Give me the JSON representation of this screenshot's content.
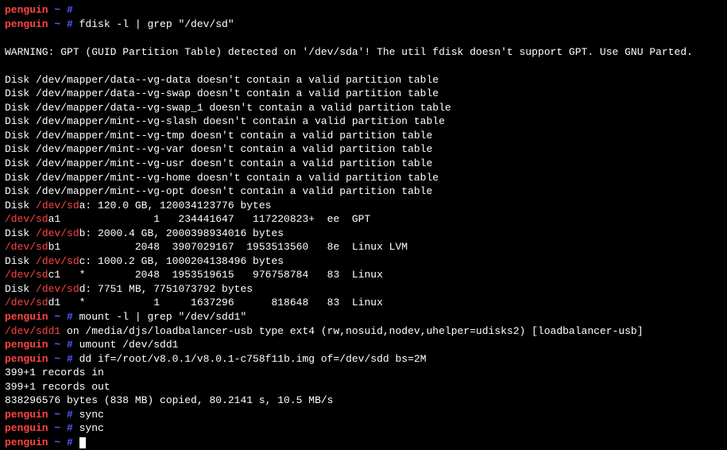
{
  "host": "penguin",
  "path": "~",
  "prompt_symbol": "#",
  "lines": [
    {
      "segments": [
        {
          "cls": "red",
          "t": "penguin"
        },
        {
          "cls": "blue",
          "t": " ~ #"
        }
      ]
    },
    {
      "segments": [
        {
          "cls": "red",
          "t": "penguin"
        },
        {
          "cls": "blue",
          "t": " ~ # "
        },
        {
          "cls": "white",
          "t": "fdisk -l | grep \"/dev/sd\""
        }
      ]
    },
    {
      "segments": [
        {
          "cls": "white",
          "t": " "
        }
      ]
    },
    {
      "segments": [
        {
          "cls": "white",
          "t": "WARNING: GPT (GUID Partition Table) detected on '/dev/sda'! The util fdisk doesn't support GPT. Use GNU Parted."
        }
      ]
    },
    {
      "segments": [
        {
          "cls": "white",
          "t": " "
        }
      ]
    },
    {
      "segments": [
        {
          "cls": "white",
          "t": "Disk /dev/mapper/data--vg-data doesn't contain a valid partition table"
        }
      ]
    },
    {
      "segments": [
        {
          "cls": "white",
          "t": "Disk /dev/mapper/data--vg-swap doesn't contain a valid partition table"
        }
      ]
    },
    {
      "segments": [
        {
          "cls": "white",
          "t": "Disk /dev/mapper/data--vg-swap_1 doesn't contain a valid partition table"
        }
      ]
    },
    {
      "segments": [
        {
          "cls": "white",
          "t": "Disk /dev/mapper/mint--vg-slash doesn't contain a valid partition table"
        }
      ]
    },
    {
      "segments": [
        {
          "cls": "white",
          "t": "Disk /dev/mapper/mint--vg-tmp doesn't contain a valid partition table"
        }
      ]
    },
    {
      "segments": [
        {
          "cls": "white",
          "t": "Disk /dev/mapper/mint--vg-var doesn't contain a valid partition table"
        }
      ]
    },
    {
      "segments": [
        {
          "cls": "white",
          "t": "Disk /dev/mapper/mint--vg-usr doesn't contain a valid partition table"
        }
      ]
    },
    {
      "segments": [
        {
          "cls": "white",
          "t": "Disk /dev/mapper/mint--vg-home doesn't contain a valid partition table"
        }
      ]
    },
    {
      "segments": [
        {
          "cls": "white",
          "t": "Disk /dev/mapper/mint--vg-opt doesn't contain a valid partition table"
        }
      ]
    },
    {
      "segments": [
        {
          "cls": "white",
          "t": "Disk "
        },
        {
          "cls": "red-dim",
          "t": "/dev/sd"
        },
        {
          "cls": "white",
          "t": "a: 120.0 GB, 120034123776 bytes"
        }
      ]
    },
    {
      "segments": [
        {
          "cls": "red-dim",
          "t": "/dev/sd"
        },
        {
          "cls": "white",
          "t": "a1               1   234441647   117220823+  ee  GPT"
        }
      ]
    },
    {
      "segments": [
        {
          "cls": "white",
          "t": "Disk "
        },
        {
          "cls": "red-dim",
          "t": "/dev/sd"
        },
        {
          "cls": "white",
          "t": "b: 2000.4 GB, 2000398934016 bytes"
        }
      ]
    },
    {
      "segments": [
        {
          "cls": "red-dim",
          "t": "/dev/sd"
        },
        {
          "cls": "white",
          "t": "b1            2048  3907029167  1953513560   8e  Linux LVM"
        }
      ]
    },
    {
      "segments": [
        {
          "cls": "white",
          "t": "Disk "
        },
        {
          "cls": "red-dim",
          "t": "/dev/sd"
        },
        {
          "cls": "white",
          "t": "c: 1000.2 GB, 1000204138496 bytes"
        }
      ]
    },
    {
      "segments": [
        {
          "cls": "red-dim",
          "t": "/dev/sd"
        },
        {
          "cls": "white",
          "t": "c1   *        2048  1953519615   976758784   83  Linux"
        }
      ]
    },
    {
      "segments": [
        {
          "cls": "white",
          "t": "Disk "
        },
        {
          "cls": "red-dim",
          "t": "/dev/sd"
        },
        {
          "cls": "white",
          "t": "d: 7751 MB, 7751073792 bytes"
        }
      ]
    },
    {
      "segments": [
        {
          "cls": "red-dim",
          "t": "/dev/sd"
        },
        {
          "cls": "white",
          "t": "d1   *           1     1637296      818648   83  Linux"
        }
      ]
    },
    {
      "segments": [
        {
          "cls": "red",
          "t": "penguin"
        },
        {
          "cls": "blue",
          "t": " ~ # "
        },
        {
          "cls": "white",
          "t": "mount -l | grep \"/dev/sdd1\""
        }
      ]
    },
    {
      "segments": [
        {
          "cls": "red-dim",
          "t": "/dev/sdd1"
        },
        {
          "cls": "white",
          "t": " on /media/djs/loadbalancer-usb type ext4 (rw,nosuid,nodev,uhelper=udisks2) [loadbalancer-usb]"
        }
      ]
    },
    {
      "segments": [
        {
          "cls": "red",
          "t": "penguin"
        },
        {
          "cls": "blue",
          "t": " ~ # "
        },
        {
          "cls": "white",
          "t": "umount /dev/sdd1"
        }
      ]
    },
    {
      "segments": [
        {
          "cls": "red",
          "t": "penguin"
        },
        {
          "cls": "blue",
          "t": " ~ # "
        },
        {
          "cls": "white",
          "t": "dd if=/root/v8.0.1/v8.0.1-c758f11b.img of=/dev/sdd bs=2M"
        }
      ]
    },
    {
      "segments": [
        {
          "cls": "white",
          "t": "399+1 records in"
        }
      ]
    },
    {
      "segments": [
        {
          "cls": "white",
          "t": "399+1 records out"
        }
      ]
    },
    {
      "segments": [
        {
          "cls": "white",
          "t": "838296576 bytes (838 MB) copied, 80.2141 s, 10.5 MB/s"
        }
      ]
    },
    {
      "segments": [
        {
          "cls": "red",
          "t": "penguin"
        },
        {
          "cls": "blue",
          "t": " ~ # "
        },
        {
          "cls": "white",
          "t": "sync"
        }
      ]
    },
    {
      "segments": [
        {
          "cls": "red",
          "t": "penguin"
        },
        {
          "cls": "blue",
          "t": " ~ # "
        },
        {
          "cls": "white",
          "t": "sync"
        }
      ]
    },
    {
      "segments": [
        {
          "cls": "red",
          "t": "penguin"
        },
        {
          "cls": "blue",
          "t": " ~ # "
        }
      ],
      "cursor": true
    }
  ]
}
